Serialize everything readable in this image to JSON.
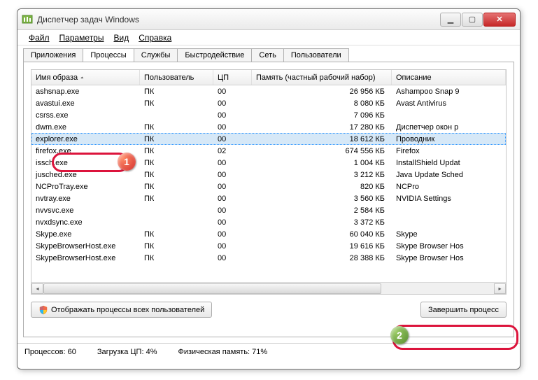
{
  "window": {
    "title": "Диспетчер задач Windows"
  },
  "menu": {
    "file": "Файл",
    "options": "Параметры",
    "view": "Вид",
    "help": "Справка"
  },
  "tabs": {
    "apps": "Приложения",
    "processes": "Процессы",
    "services": "Службы",
    "performance": "Быстродействие",
    "network": "Сеть",
    "users": "Пользователи"
  },
  "columns": {
    "image": "Имя образа",
    "user": "Пользователь",
    "cpu": "ЦП",
    "memory": "Память (частный рабочий набор)",
    "description": "Описание"
  },
  "rows": [
    {
      "img": "ashsnap.exe",
      "user": "ПК",
      "cpu": "00",
      "mem": "26 956 КБ",
      "desc": "Ashampoo Snap 9"
    },
    {
      "img": "avastui.exe",
      "user": "ПК",
      "cpu": "00",
      "mem": "8 080 КБ",
      "desc": "Avast Antivirus"
    },
    {
      "img": "csrss.exe",
      "user": "",
      "cpu": "00",
      "mem": "7 096 КБ",
      "desc": ""
    },
    {
      "img": "dwm.exe",
      "user": "ПК",
      "cpu": "00",
      "mem": "17 280 КБ",
      "desc": "Диспетчер окон р"
    },
    {
      "img": "explorer.exe",
      "user": "ПК",
      "cpu": "00",
      "mem": "18 612 КБ",
      "desc": "Проводник",
      "selected": true
    },
    {
      "img": "firefox.exe",
      "user": "ПК",
      "cpu": "02",
      "mem": "674 556 КБ",
      "desc": "Firefox"
    },
    {
      "img": "issch.exe",
      "user": "ПК",
      "cpu": "00",
      "mem": "1 004 КБ",
      "desc": "InstallShield Updat"
    },
    {
      "img": "jusched.exe",
      "user": "ПК",
      "cpu": "00",
      "mem": "3 212 КБ",
      "desc": "Java Update Sched"
    },
    {
      "img": "NCProTray.exe",
      "user": "ПК",
      "cpu": "00",
      "mem": "820 КБ",
      "desc": "NCPro"
    },
    {
      "img": "nvtray.exe",
      "user": "ПК",
      "cpu": "00",
      "mem": "3 560 КБ",
      "desc": "NVIDIA Settings"
    },
    {
      "img": "nvvsvc.exe",
      "user": "",
      "cpu": "00",
      "mem": "2 584 КБ",
      "desc": ""
    },
    {
      "img": "nvxdsync.exe",
      "user": "",
      "cpu": "00",
      "mem": "3 372 КБ",
      "desc": ""
    },
    {
      "img": "Skype.exe",
      "user": "ПК",
      "cpu": "00",
      "mem": "60 040 КБ",
      "desc": "Skype"
    },
    {
      "img": "SkypeBrowserHost.exe",
      "user": "ПК",
      "cpu": "00",
      "mem": "19 616 КБ",
      "desc": "Skype Browser Hos"
    },
    {
      "img": "SkypeBrowserHost.exe",
      "user": "ПК",
      "cpu": "00",
      "mem": "28 388 КБ",
      "desc": "Skype Browser Hos"
    }
  ],
  "buttons": {
    "show_all": "Отображать процессы всех пользователей",
    "end_process": "Завершить процесс"
  },
  "status": {
    "processes": "Процессов: 60",
    "cpu": "Загрузка ЦП: 4%",
    "memory": "Физическая память: 71%"
  },
  "badges": {
    "b1": "1",
    "b2": "2"
  }
}
